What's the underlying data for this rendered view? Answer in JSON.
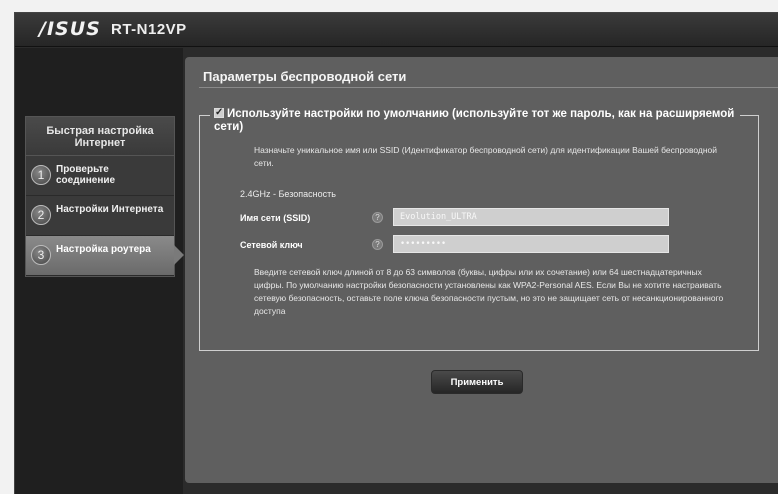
{
  "header": {
    "brand": "/ISUS",
    "model": "RT-N12VP"
  },
  "sidebar": {
    "title": "Быстрая настройка Интернет",
    "steps": [
      {
        "number": "1",
        "label": "Проверьте соединение"
      },
      {
        "number": "2",
        "label": "Настройки Интернета"
      },
      {
        "number": "3",
        "label": "Настройка роутера",
        "active": true
      }
    ]
  },
  "main": {
    "title": "Параметры беспроводной сети",
    "default_settings_label": "Используйте настройки по умолчанию (используйте тот же пароль, как на расширяемой сети)",
    "default_settings_checked": true,
    "intro": "Назначьте уникальное имя или SSID (Идентификатор беспроводной сети) для идентификации Вашей беспроводной сети.",
    "band_label": "2.4GHz - Безопасность",
    "ssid": {
      "label": "Имя сети (SSID)",
      "value": "Evolution_ULTRA"
    },
    "key": {
      "label": "Сетевой ключ",
      "value": "•••••••••"
    },
    "help_icon": "?",
    "warning": "Введите сетевой ключ длиной от 8 до 63 символов (буквы, цифры или их сочетание) или 64 шестнадцатеричных цифры. По умолчанию настройки безопасности установлены как WPA2-Personal AES. Если Вы не хотите настраивать сетевую безопасность, оставьте поле ключа безопасности пустым, но это не защищает сеть от несанкционированного доступа",
    "apply_button": "Применить"
  },
  "colors": {
    "frame": "#2b2b2b",
    "panel": "#5f5f5f",
    "field": "#cfcfcf"
  }
}
